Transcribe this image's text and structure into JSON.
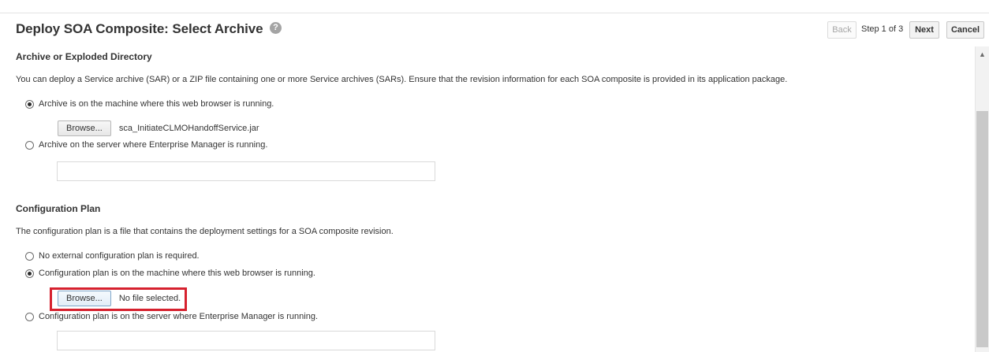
{
  "header": {
    "title": "Deploy SOA Composite: Select Archive",
    "help_icon": "?",
    "back_label": "Back",
    "step_text": "Step 1 of 3",
    "next_label": "Next",
    "cancel_label": "Cancel"
  },
  "archive_section": {
    "title": "Archive or Exploded Directory",
    "description": "You can deploy a Service archive (SAR) or a ZIP file containing one or more Service archives (SARs). Ensure that the revision information for each SOA composite is provided in its application package.",
    "option_local": "Archive is on the machine where this web browser is running.",
    "option_local_selected": true,
    "browse_label": "Browse...",
    "selected_file": "sca_InitiateCLMOHandoffService.jar",
    "option_server": "Archive on the server where Enterprise Manager is running.",
    "server_path_value": ""
  },
  "config_section": {
    "title": "Configuration Plan",
    "description": "The configuration plan is a file that contains the deployment settings for a SOA composite revision.",
    "option_none": "No external configuration plan is required.",
    "option_local": "Configuration plan is on the machine where this web browser is running.",
    "option_local_selected": true,
    "browse_label": "Browse...",
    "selected_file": "No file selected.",
    "option_server": "Configuration plan is on the server where Enterprise Manager is running.",
    "server_path_value": ""
  },
  "colors": {
    "highlight": "#d6212e",
    "title_text": "#333333"
  },
  "icons": {
    "help": "help-icon",
    "scroll_up": "chevron-up-icon"
  }
}
